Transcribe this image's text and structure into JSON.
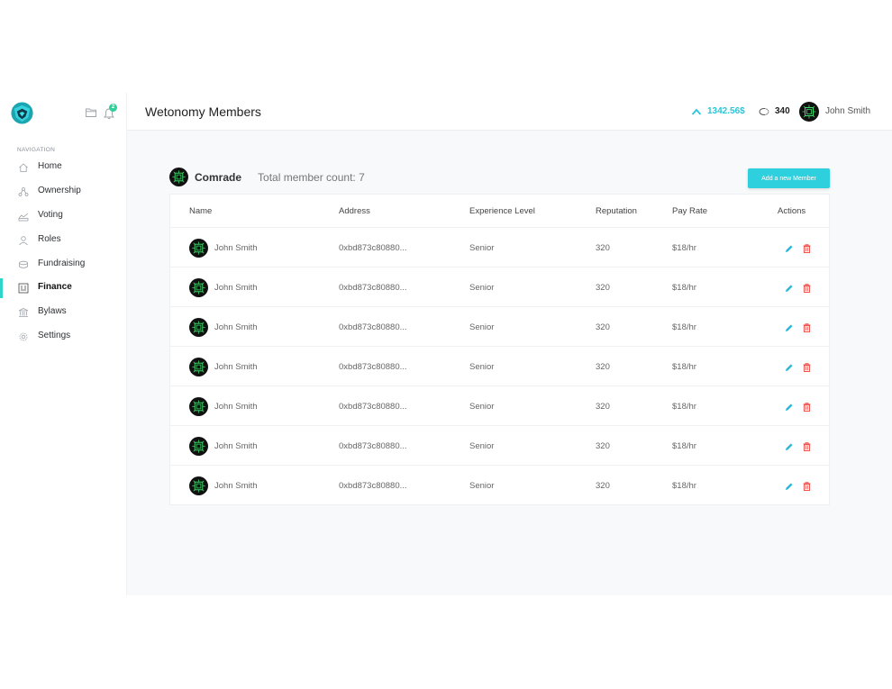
{
  "app": {
    "notification_count": "2"
  },
  "sidebar": {
    "heading": "NAVIGATION",
    "items": [
      {
        "label": "Home",
        "icon": "home-icon"
      },
      {
        "label": "Ownership",
        "icon": "ownership-icon"
      },
      {
        "label": "Voting",
        "icon": "voting-icon"
      },
      {
        "label": "Roles",
        "icon": "roles-icon"
      },
      {
        "label": "Fundraising",
        "icon": "fundraising-icon"
      },
      {
        "label": "Finance",
        "icon": "finance-icon",
        "active": true
      },
      {
        "label": "Bylaws",
        "icon": "bylaws-icon"
      },
      {
        "label": "Settings",
        "icon": "settings-icon"
      }
    ]
  },
  "header": {
    "title": "Wetonomy Members",
    "balance": "1342.56$",
    "reputation": "340",
    "user_name": "John Smith"
  },
  "org": {
    "name": "Comrade",
    "member_count": "Total member count: 7",
    "add_button": "Add a new Member"
  },
  "table": {
    "headers": [
      "Name",
      "Address",
      "Experience Level",
      "Reputation",
      "Pay Rate",
      "Actions"
    ],
    "rows": [
      {
        "name": "John Smith",
        "address": "0xbd873c80880...",
        "level": "Senior",
        "reputation": "320",
        "pay": "$18/hr"
      },
      {
        "name": "John Smith",
        "address": "0xbd873c80880...",
        "level": "Senior",
        "reputation": "320",
        "pay": "$18/hr"
      },
      {
        "name": "John Smith",
        "address": "0xbd873c80880...",
        "level": "Senior",
        "reputation": "320",
        "pay": "$18/hr"
      },
      {
        "name": "John Smith",
        "address": "0xbd873c80880...",
        "level": "Senior",
        "reputation": "320",
        "pay": "$18/hr"
      },
      {
        "name": "John Smith",
        "address": "0xbd873c80880...",
        "level": "Senior",
        "reputation": "320",
        "pay": "$18/hr"
      },
      {
        "name": "John Smith",
        "address": "0xbd873c80880...",
        "level": "Senior",
        "reputation": "320",
        "pay": "$18/hr"
      },
      {
        "name": "John Smith",
        "address": "0xbd873c80880...",
        "level": "Senior",
        "reputation": "320",
        "pay": "$18/hr"
      }
    ]
  },
  "colors": {
    "accent": "#2fd0dd",
    "active_bar": "#2dd4c9",
    "edit": "#2bb6d8",
    "delete": "#f0554f",
    "badge": "#2ecf9a"
  }
}
